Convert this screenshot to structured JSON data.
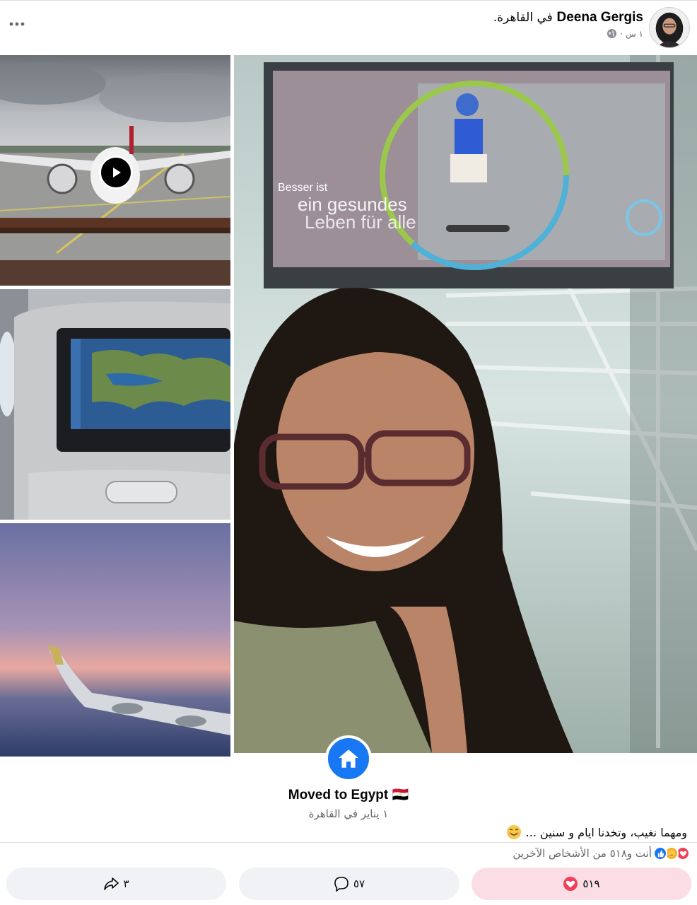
{
  "post": {
    "author": "Deena Gergis",
    "location_text": "في القاهرة.",
    "time": "١ س",
    "separator": "·",
    "audience_icon": "globe-icon",
    "more_icon": "ellipsis-icon"
  },
  "media": {
    "play_icon": "play-icon"
  },
  "life_event": {
    "icon": "home-icon",
    "title": "Moved to Egypt 🇪🇬",
    "subtitle": "١ يناير في القاهرة"
  },
  "caption": {
    "text": "ومهما نغيب، وتخدنا ايام و سنين ...",
    "emoji": "smiling-face-icon"
  },
  "reactions": {
    "summary": "أنت و٥١٨ من الأشخاص الآخرين",
    "icons": [
      "love-icon",
      "care-icon",
      "like-icon"
    ]
  },
  "actions": {
    "like_count": "٥١٩",
    "comment_count": "٥٧",
    "share_count": "٣"
  },
  "colors": {
    "accent_blue": "#1877f2",
    "love_red": "#f33e58",
    "like_button_bg": "#fbdde5",
    "button_bg": "#f0f2f5",
    "secondary_text": "#65676b"
  }
}
